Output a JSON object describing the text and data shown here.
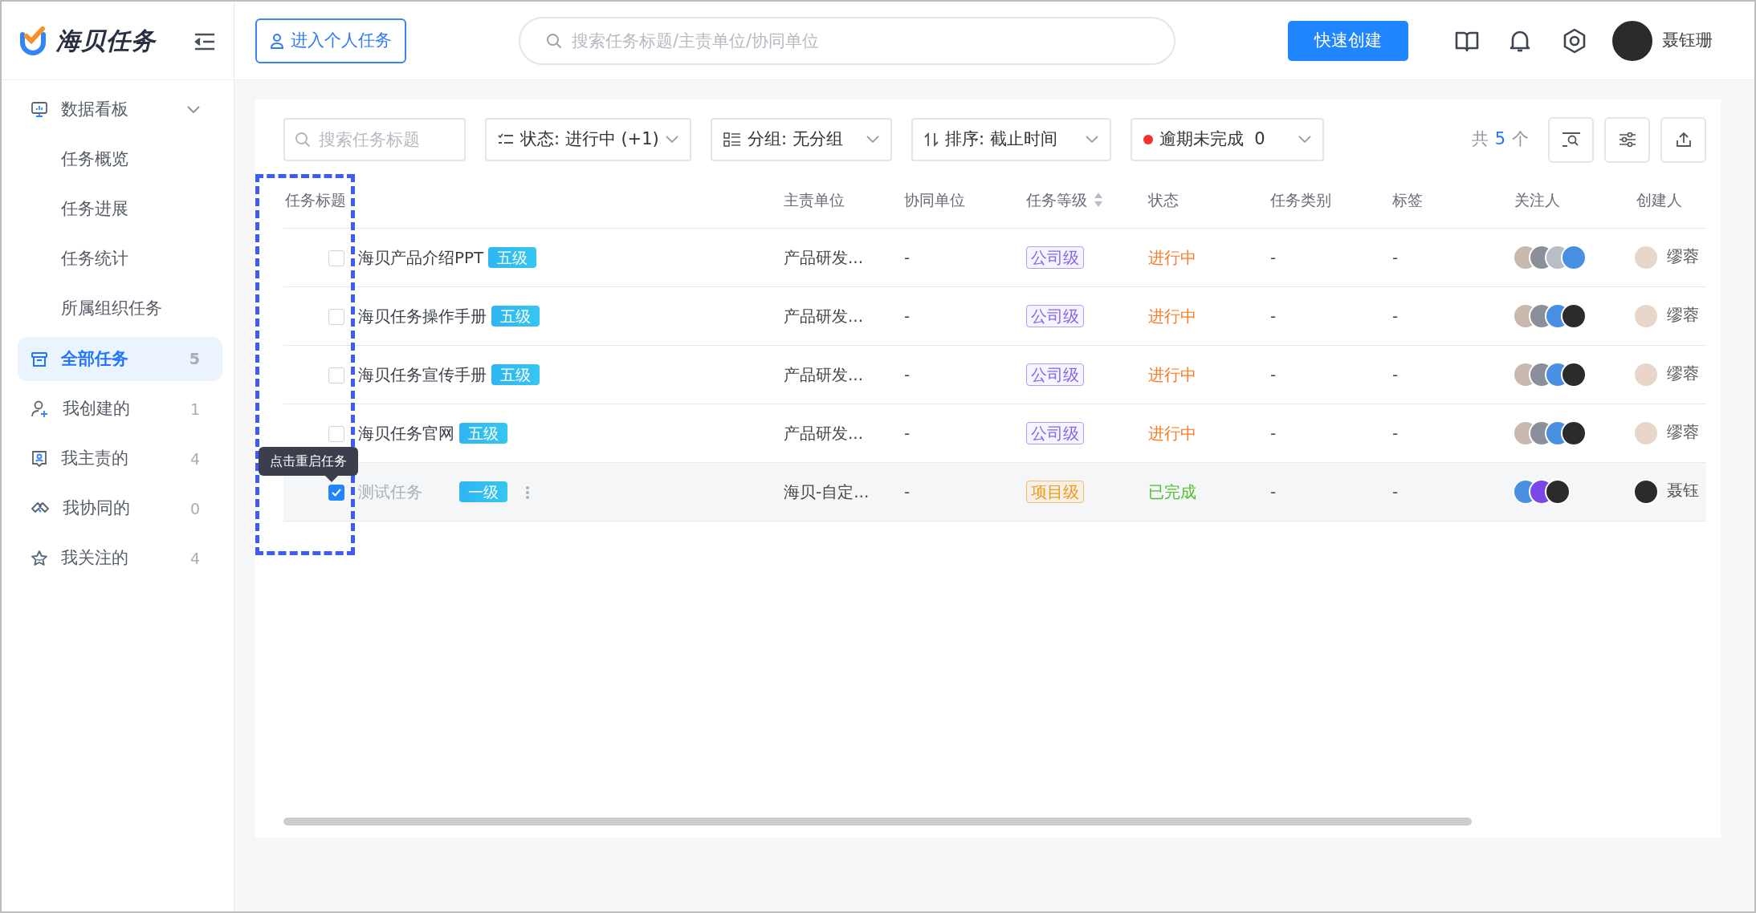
{
  "app": {
    "title": "海贝任务"
  },
  "topbar": {
    "personal_button": "进入个人任务",
    "search": {
      "placeholder": "搜索任务标题/主责单位/协同单位"
    },
    "create_button": "快速创建",
    "user": "聂钰珊"
  },
  "sidebar": {
    "items": [
      {
        "label": "数据看板",
        "kind": "group",
        "expanded": true,
        "children": [
          {
            "label": "任务概览",
            "selected": false
          },
          {
            "label": "任务进展",
            "selected": false
          },
          {
            "label": "任务统计",
            "selected": false
          },
          {
            "label": "所属组织任务",
            "selected": false
          }
        ]
      },
      {
        "label": "全部任务",
        "kind": "item",
        "count": "5",
        "selected": true
      },
      {
        "label": "我创建的",
        "kind": "item",
        "count": "1",
        "selected": false
      },
      {
        "label": "我主责的",
        "kind": "item",
        "count": "4",
        "selected": false
      },
      {
        "label": "我协同的",
        "kind": "item",
        "count": "0",
        "selected": false
      },
      {
        "label": "我关注的",
        "kind": "item",
        "count": "4",
        "selected": false
      }
    ]
  },
  "filters": {
    "search": {
      "placeholder": "搜索任务标题"
    },
    "dropdowns": [
      {
        "kind": "status",
        "label": "状态: 进行中 (+1)"
      },
      {
        "kind": "group",
        "label": "分组: 无分组"
      },
      {
        "kind": "sort",
        "label": "排序: 截止时间"
      },
      {
        "kind": "overdue",
        "label": "逾期未完成  0",
        "color": "#f5312d"
      }
    ],
    "total_prefix": "共",
    "total": "5",
    "total_suffix": "个"
  },
  "table": {
    "columns": [
      {
        "label": "任务标题"
      },
      {
        "label": "主责单位"
      },
      {
        "label": "协同单位"
      },
      {
        "label": "任务等级",
        "sortable": true
      },
      {
        "label": "状态"
      },
      {
        "label": "任务类别"
      },
      {
        "label": "标签"
      },
      {
        "label": "关注人"
      },
      {
        "label": "创建人"
      }
    ],
    "rows": [
      {
        "checked": false,
        "hovered": false,
        "title": "海贝产品介绍PPT",
        "level_tag": "五级",
        "unit": "产品研发...",
        "co_unit": "-",
        "grade": {
          "text": "公司级",
          "color": "#8566ee"
        },
        "status": {
          "text": "进行中",
          "color": "#fa7a23"
        },
        "category": "-",
        "tags": "-",
        "followers": [
          {
            "color": "#c9b8ad"
          },
          {
            "color": "#8a8f99"
          },
          {
            "color": "#b9bec6"
          },
          {
            "color": "#4a90e2"
          }
        ],
        "creator": {
          "name": "缪蓉",
          "color": "#e8d6ca"
        }
      },
      {
        "checked": false,
        "hovered": false,
        "title": "海贝任务操作手册",
        "level_tag": "五级",
        "unit": "产品研发...",
        "co_unit": "-",
        "grade": {
          "text": "公司级",
          "color": "#8566ee"
        },
        "status": {
          "text": "进行中",
          "color": "#fa7a23"
        },
        "category": "-",
        "tags": "-",
        "followers": [
          {
            "color": "#c9b8ad"
          },
          {
            "color": "#8a8f99"
          },
          {
            "color": "#4a90e2"
          },
          {
            "color": "#2b2b2b"
          }
        ],
        "creator": {
          "name": "缪蓉",
          "color": "#e8d6ca"
        }
      },
      {
        "checked": false,
        "hovered": false,
        "title": "海贝任务宣传手册",
        "level_tag": "五级",
        "unit": "产品研发...",
        "co_unit": "-",
        "grade": {
          "text": "公司级",
          "color": "#8566ee"
        },
        "status": {
          "text": "进行中",
          "color": "#fa7a23"
        },
        "category": "-",
        "tags": "-",
        "followers": [
          {
            "color": "#c9b8ad"
          },
          {
            "color": "#8a8f99"
          },
          {
            "color": "#4a90e2"
          },
          {
            "color": "#2b2b2b"
          }
        ],
        "creator": {
          "name": "缪蓉",
          "color": "#e8d6ca"
        }
      },
      {
        "checked": false,
        "hovered": false,
        "title": "海贝任务官网",
        "level_tag": "五级",
        "unit": "产品研发...",
        "co_unit": "-",
        "grade": {
          "text": "公司级",
          "color": "#8566ee"
        },
        "status": {
          "text": "进行中",
          "color": "#fa7a23"
        },
        "category": "-",
        "tags": "-",
        "followers": [
          {
            "color": "#c9b8ad"
          },
          {
            "color": "#8a8f99"
          },
          {
            "color": "#4a90e2"
          },
          {
            "color": "#2b2b2b"
          }
        ],
        "creator": {
          "name": "缪蓉",
          "color": "#e8d6ca"
        }
      },
      {
        "checked": true,
        "hovered": true,
        "title": "测试任务",
        "level_tag": "一级",
        "unit": "海贝-自定...",
        "co_unit": "-",
        "grade": {
          "text": "项目级",
          "color": "#f29b14"
        },
        "status": {
          "text": "已完成",
          "color": "#4fbf2a"
        },
        "category": "-",
        "tags": "-",
        "followers": [
          {
            "color": "#4a90e2"
          },
          {
            "color": "#7a48e6"
          },
          {
            "color": "#2b2b2b"
          }
        ],
        "creator": {
          "name": "聂钰",
          "color": "#2b2b2b"
        }
      }
    ]
  },
  "tooltip": {
    "text": "点击重启任务"
  },
  "annotation": {
    "kind": "dashed-frame"
  }
}
